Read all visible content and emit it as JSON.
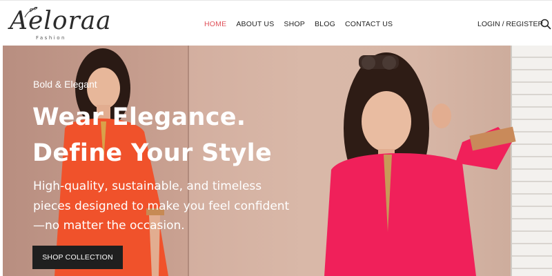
{
  "brand": {
    "name": "Aeloraa",
    "tagline": "Fashion"
  },
  "nav": {
    "items": [
      {
        "label": "HOME",
        "active": true
      },
      {
        "label": "ABOUT US",
        "active": false
      },
      {
        "label": "SHOP",
        "active": false
      },
      {
        "label": "BLOG",
        "active": false
      },
      {
        "label": "CONTACT US",
        "active": false
      }
    ],
    "login_label": "LOGIN / REGISTER",
    "search_icon": "search-icon"
  },
  "hero": {
    "eyebrow": "Bold & Elegant",
    "headline_line1": "Wear Elegance.",
    "headline_line2": "Define Your Style",
    "subtext_line1": "High-quality, sustainable, and timeless",
    "subtext_line2": "pieces designed to make you feel confident",
    "subtext_line3": "—no matter the occasion.",
    "cta_label": "SHOP COLLECTION"
  },
  "colors": {
    "accent": "#e0525a",
    "cta_bg": "#1f1f1f",
    "hero_bg": "#d2ad9e",
    "dress_left": "#f0522b",
    "dress_right": "#f0205a"
  }
}
